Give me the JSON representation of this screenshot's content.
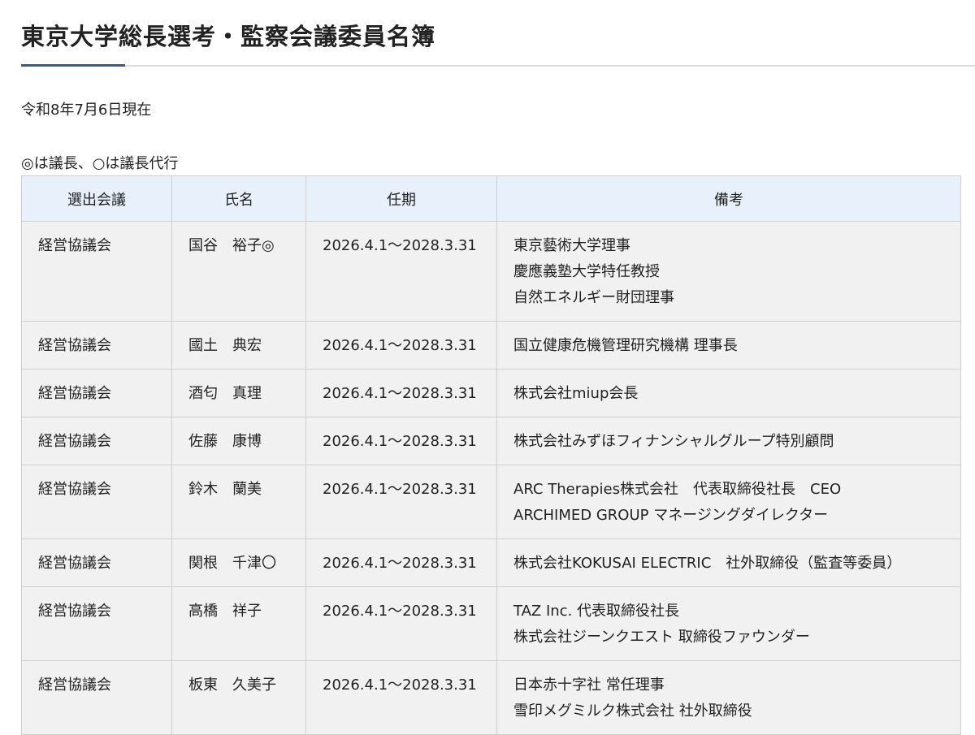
{
  "page": {
    "title": "東京大学総長選考・監察会議委員名簿",
    "as_of": "令和8年7月6日現在",
    "legend_note": "◎は議長、○は議長代行"
  },
  "table": {
    "headers": [
      "選出会議",
      "氏名",
      "任期",
      "備考"
    ],
    "rows": [
      {
        "council": "経営協議会",
        "name": "国谷　裕子◎",
        "term": "2026.4.1～2028.3.31",
        "notes": [
          "東京藝術大学理事",
          "慶應義塾大学特任教授",
          "自然エネルギー財団理事"
        ]
      },
      {
        "council": "経営協議会",
        "name": "國土　典宏",
        "term": "2026.4.1～2028.3.31",
        "notes": [
          "国立健康危機管理研究機構 理事長"
        ]
      },
      {
        "council": "経営協議会",
        "name": "酒匂　真理",
        "term": "2026.4.1～2028.3.31",
        "notes": [
          "株式会社miup会長"
        ]
      },
      {
        "council": "経営協議会",
        "name": "佐藤　康博",
        "term": "2026.4.1～2028.3.31",
        "notes": [
          "株式会社みずほフィナンシャルグループ特別顧問"
        ]
      },
      {
        "council": "経営協議会",
        "name": "鈴木　蘭美",
        "term": "2026.4.1～2028.3.31",
        "notes": [
          "ARC Therapies株式会社　代表取締役社長　CEO",
          "ARCHIMED GROUP マネージングダイレクター"
        ]
      },
      {
        "council": "経営協議会",
        "name": "関根　千津〇",
        "term": "2026.4.1～2028.3.31",
        "notes": [
          "株式会社KOKUSAI ELECTRIC　社外取締役（監査等委員）"
        ]
      },
      {
        "council": "経営協議会",
        "name": "高橋　祥子",
        "term": "2026.4.1～2028.3.31",
        "notes": [
          "TAZ Inc. 代表取締役社長",
          "株式会社ジーンクエスト 取締役ファウンダー"
        ]
      },
      {
        "council": "経営協議会",
        "name": "板東　久美子",
        "term": "2026.4.1～2028.3.31",
        "notes": [
          "日本赤十字社 常任理事",
          "雪印メグミルク株式会社 社外取締役"
        ]
      }
    ]
  }
}
